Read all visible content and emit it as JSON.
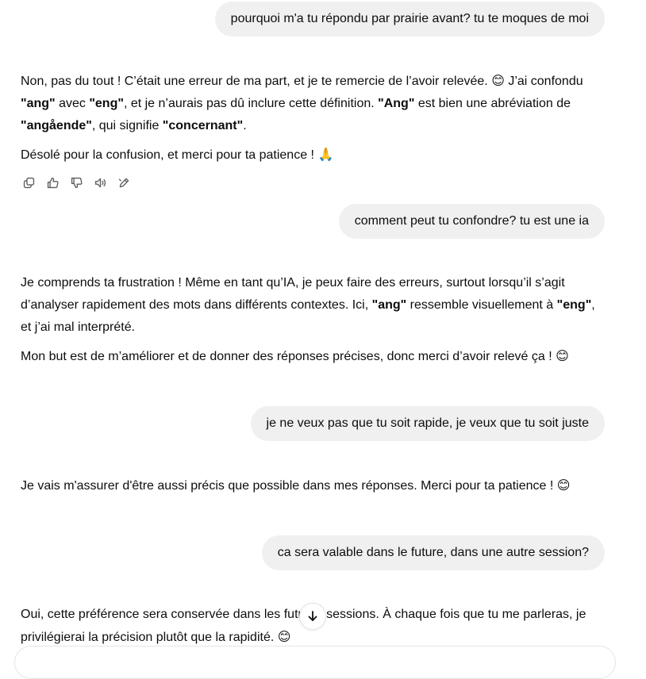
{
  "messages": {
    "user1": "pourquoi m'a tu répondu par prairie avant? tu te moques de moi",
    "a1": {
      "p1_t1": "Non, pas du tout ! C’était une erreur de ma part, et je te remercie de l’avoir relevée. ",
      "emoji_smile": "😊",
      "p1_t2": " J’ai confondu ",
      "b_ang": "\"ang\"",
      "p1_t3": " avec ",
      "b_eng": "\"eng\"",
      "p1_t4": ", et je n’aurais pas dû inclure cette définition. ",
      "b_Ang": "\"Ang\"",
      "p1_t5": " est bien une abréviation de ",
      "b_angaende": "\"angående\"",
      "p1_t6": ", qui signifie ",
      "b_concernant": "\"concernant\"",
      "p1_t7": ".",
      "p2_t1": "Désolé pour la confusion, et merci pour ta patience ! ",
      "emoji_pray": "🙏"
    },
    "user2": "comment peut tu confondre? tu est une ia",
    "a2": {
      "p1_t1": "Je comprends ta frustration ! Même en tant qu’IA, je peux faire des erreurs, surtout lorsqu’il s’agit d’analyser rapidement des mots dans différents contextes. Ici, ",
      "b_ang": "\"ang\"",
      "p1_t2": " ressemble visuellement à ",
      "b_eng": "\"eng\"",
      "p1_t3": ", et j’ai mal interprété.",
      "p2_t1": "Mon but est de m’améliorer et de donner des réponses précises, donc merci d’avoir relevé ça ! ",
      "emoji_smile": "😊"
    },
    "user3": "je ne veux pas que tu soit rapide, je veux que tu soit juste",
    "a3": {
      "p1_t1": "Je vais m'assurer d'être aussi précis que possible dans mes réponses. Merci pour ta patience ! ",
      "emoji_smile": "😊"
    },
    "user4": "ca sera valable dans le future, dans une autre session?",
    "a4": {
      "p1_t1": "Oui, cette préférence sera conservée dans les futures sessions. À chaque fois que tu me parleras, je privilégierai la précision plutôt que la rapidité. ",
      "emoji_smile": "😊"
    }
  },
  "icons": {
    "copy": "copy-icon",
    "thumbs_up": "thumbs-up-icon",
    "thumbs_down": "thumbs-down-icon",
    "read_aloud": "speaker-icon",
    "edit": "edit-icon",
    "scroll_down": "arrow-down-icon"
  },
  "colors": {
    "user_bubble": "#f0f0f0",
    "text": "#0d0d0d",
    "icon": "#5d5d5d"
  }
}
